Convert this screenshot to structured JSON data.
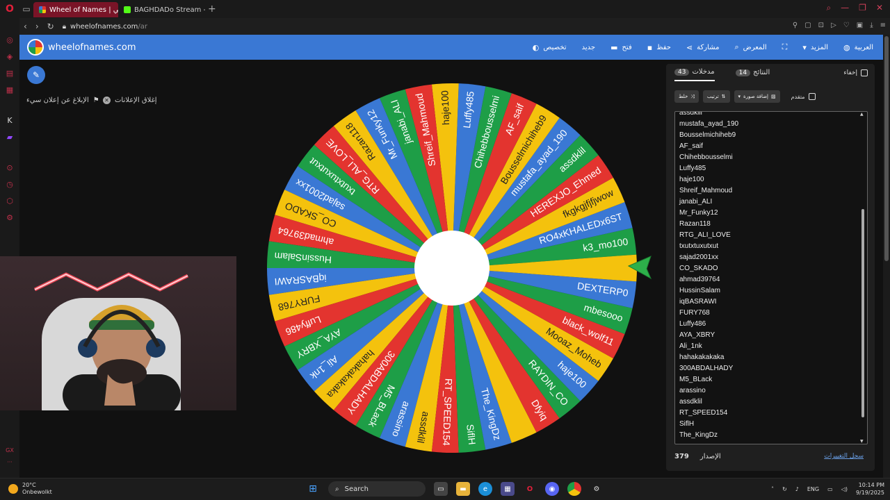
{
  "browser": {
    "tabs": [
      {
        "label": "Wheel of Names | عشوائي",
        "active": true
      },
      {
        "label": "BAGHDADo Stream - Wat",
        "active": false
      }
    ],
    "url_host": "wheelofnames.com",
    "url_path": "/ar"
  },
  "site": {
    "title": "wheelofnames.com",
    "menu": {
      "customize": "تخصيص",
      "new": "جديد",
      "open": "فتح",
      "save": "حفظ",
      "share": "مشاركة",
      "gallery": "المعرض",
      "more": "المزيد",
      "language": "العربية"
    },
    "ads": {
      "close": "إغلاق الإعلانات",
      "report": "الإبلاغ عن إعلان سيء"
    }
  },
  "panel": {
    "tab_entries": "مدخلات",
    "entries_count": "43",
    "tab_results": "النتائج",
    "results_count": "14",
    "hide": "إخفاء",
    "shuffle": "خلط",
    "sort": "ترتيب",
    "add_image": "إضافة صورة",
    "advanced": "متقدم",
    "version_label": "الإصدار",
    "version_number": "379",
    "changelog": "سجل التغييرات"
  },
  "entries": [
    "assdklil",
    "mustafa_ayad_190",
    "Bousselmichiheb9",
    "AF_saif",
    "Chihebbousselmi",
    "Luffy485",
    "haje100",
    "Shreif_Mahmoud",
    "janabi_ALI",
    "Mr_Funky12",
    "Razan118",
    "RTG_ALI_LOVE",
    "txutxtuxutxut",
    "sajad2001xx",
    "CO_SKADO",
    "ahmad39764",
    "HussinSalam",
    "iqBASRAWI",
    "FURY768",
    "Luffy486",
    "AYA_XBRY",
    "Ali_1nk",
    "hahakakakaka",
    "300ABDALHADY",
    "M5_BLack",
    "arassino",
    "assdklil",
    "RT_SPEED154",
    "SiflH",
    "The_KingDz"
  ],
  "wheel": {
    "colors": [
      "#1e9e47",
      "#3a78d4",
      "#f4c20d",
      "#e3342f"
    ],
    "labels": [
      "k3_mo100",
      "RO4xKHALEDx6ST",
      "fkgkgjfjfjwow",
      "HEREXJO_Ehmed",
      "assdklil",
      "mustafa_ayad_190",
      "Bousselmichiheb9",
      "AF_saif",
      "Chihebbousselmi",
      "Luffy485",
      "haje100",
      "Shreif_Mahmoud",
      "janabi_ALI",
      "Mr_Funky12",
      "Razan118",
      "RTG_ALI_LOVE",
      "txutxtuxutxut",
      "sajad2001xx",
      "CO_SKADO",
      "ahmad39764",
      "HussinSalam",
      "iqBASRAWI",
      "FURY768",
      "Luffy486",
      "AYA_XBRY",
      "Ali_1nk",
      "hahakakakaka",
      "300ABDALHADY",
      "M5_BLack",
      "arassino",
      "assdklil",
      "RT_SPEED154",
      "SiflH",
      "The_KingDz",
      "",
      "Dfyiq",
      "RAYDIN_CO",
      "haje100",
      "Mooaz_Moheb",
      "black_wolf11",
      "mbesooo",
      "DEXTERP0",
      ""
    ]
  },
  "taskbar": {
    "temp": "20°C",
    "weather": "Onbewolkt",
    "search": "Search",
    "lang": "ENG",
    "time": "10:14 PM",
    "date": "9/19/2025"
  }
}
